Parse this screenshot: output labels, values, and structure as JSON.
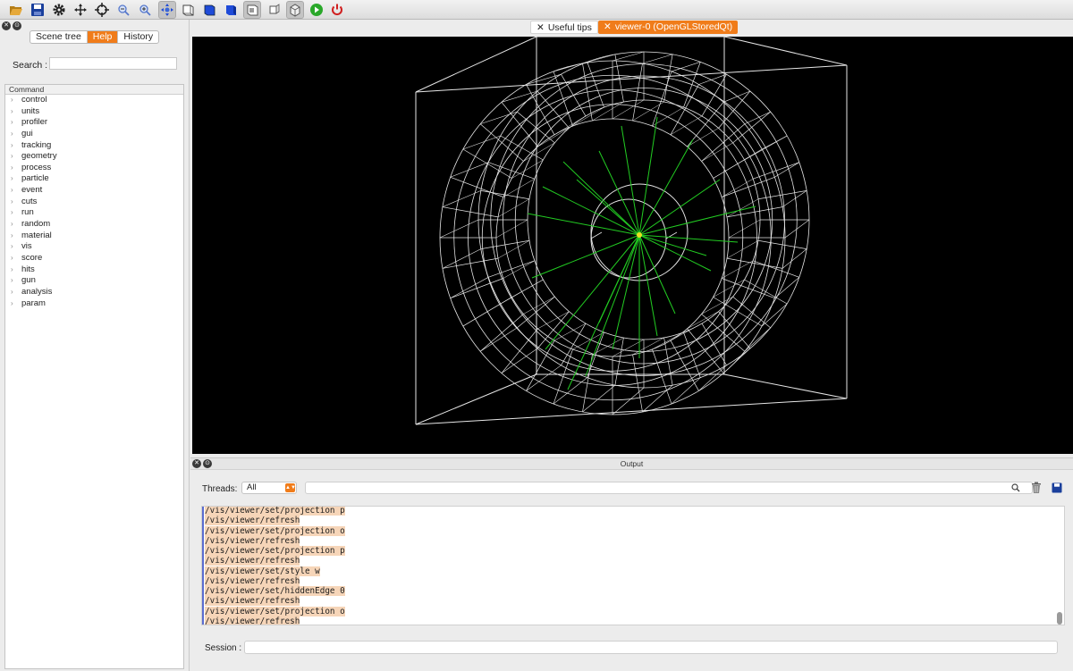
{
  "toolbar": {
    "items": [
      {
        "name": "open-icon",
        "color": "#d99a28"
      },
      {
        "name": "save-icon",
        "color": "#1a3f9c"
      },
      {
        "name": "gear-icon",
        "color": "#222222"
      },
      {
        "name": "move-icon",
        "color": "#222222"
      },
      {
        "name": "rotate-icon",
        "color": "#222222"
      },
      {
        "name": "zoom-out-icon",
        "color": "#5577cc"
      },
      {
        "name": "zoom-in-icon",
        "color": "#5577cc"
      },
      {
        "name": "perspective-icon",
        "color": "#3a66d8"
      },
      {
        "name": "wireframe-icon",
        "color": "#444444"
      },
      {
        "name": "solid-icon",
        "color": "#1f4bd8"
      },
      {
        "name": "surface-icon",
        "color": "#1f4bd8"
      },
      {
        "name": "hidden-line-icon",
        "color": "#555555"
      },
      {
        "name": "ortho-icon",
        "color": "#555555"
      },
      {
        "name": "box-icon",
        "color": "#555555"
      },
      {
        "name": "run-icon",
        "color": "#2aa82a"
      },
      {
        "name": "power-icon",
        "color": "#d02020"
      }
    ]
  },
  "left": {
    "tabs": [
      {
        "label": "Scene tree",
        "selected": false
      },
      {
        "label": "Help",
        "selected": true
      },
      {
        "label": "History",
        "selected": false
      }
    ],
    "search_label": "Search :",
    "tree_header": "Command",
    "commands": [
      "control",
      "units",
      "profiler",
      "gui",
      "tracking",
      "geometry",
      "process",
      "particle",
      "event",
      "cuts",
      "run",
      "random",
      "material",
      "vis",
      "score",
      "hits",
      "gun",
      "analysis",
      "param"
    ]
  },
  "viewer_tabs": [
    {
      "label": "Useful tips",
      "active": false
    },
    {
      "label": "viewer-0 (OpenGLStoredQt)",
      "active": true
    }
  ],
  "output": {
    "title": "Output",
    "threads_label": "Threads:",
    "threads_value": "All",
    "log": [
      "/vis/viewer/set/projection p",
      "/vis/viewer/refresh",
      "/vis/viewer/set/projection o",
      "/vis/viewer/refresh",
      "/vis/viewer/set/projection p",
      "/vis/viewer/refresh",
      "/vis/viewer/set/style w",
      "/vis/viewer/refresh",
      "/vis/viewer/set/hiddenEdge 0",
      "/vis/viewer/refresh",
      "/vis/viewer/set/projection o",
      "/vis/viewer/refresh"
    ],
    "session_label": "Session :"
  },
  "colors": {
    "accent": "#f07c1a",
    "track": "#22cc22",
    "wire": "#e6e6e6",
    "log_highlight": "#f6d5b8"
  }
}
